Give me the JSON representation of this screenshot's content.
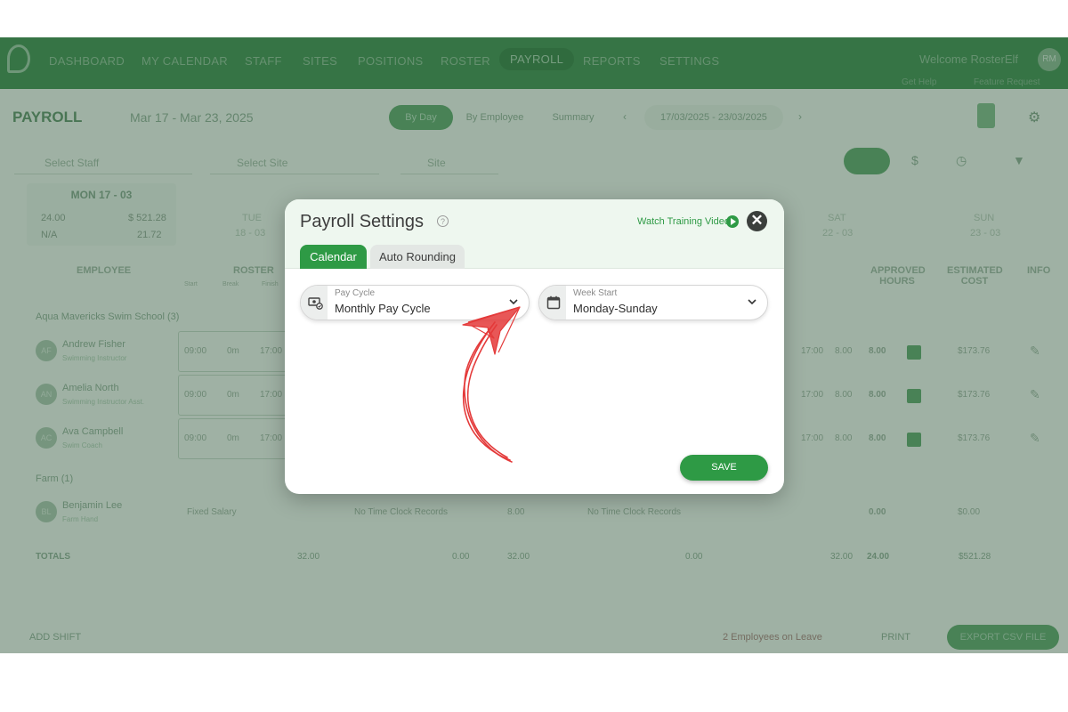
{
  "nav": {
    "items": [
      "DASHBOARD",
      "MY CALENDAR",
      "STAFF",
      "SITES",
      "POSITIONS",
      "ROSTER",
      "PAYROLL",
      "REPORTS",
      "SETTINGS"
    ],
    "active": "PAYROLL",
    "welcome": "Welcome RosterElf",
    "avatar": "RM",
    "get_help": "Get Help",
    "feature_request": "Feature Request"
  },
  "toolbar": {
    "title": "PAYROLL",
    "date_range": "Mar 17 - Mar 23, 2025",
    "seg_by_day": "By Day",
    "seg_by_employee": "By Employee",
    "seg_summary": "Summary",
    "range_value": "17/03/2025 - 23/03/2025"
  },
  "filters": {
    "staff": "Select Staff",
    "site": "Select Site",
    "group": "Site"
  },
  "day_card": {
    "title": "MON 17 - 03",
    "hours": "24.00",
    "cost": "$ 521.28",
    "pct": "N/A",
    "avg": "21.72"
  },
  "other_days": [
    {
      "label": "TUE",
      "date": "18 - 03"
    },
    {
      "label": "SAT",
      "date": "22 - 03"
    },
    {
      "label": "SUN",
      "date": "23 - 03"
    }
  ],
  "table": {
    "h_employee": "EMPLOYEE",
    "h_roster": "ROSTER",
    "h_approved": "APPROVED HOURS",
    "h_est_cost": "ESTIMATED COST",
    "h_info": "INFO",
    "sub_start": "Start",
    "sub_break": "Break",
    "sub_finish": "Finish",
    "group1": "Aqua Mavericks Swim School (3)",
    "group2": "Farm (1)",
    "rows": [
      {
        "initials": "AF",
        "name": "Andrew Fisher",
        "role": "Swimming Instructor",
        "start": "09:00",
        "brk": "0m",
        "finish": "17:00",
        "end": "17:00",
        "hrs": "8.00",
        "appr": "8.00",
        "cost": "$173.76"
      },
      {
        "initials": "AN",
        "name": "Amelia North",
        "role": "Swimming Instructor Asst.",
        "start": "09:00",
        "brk": "0m",
        "finish": "17:00",
        "end": "17:00",
        "hrs": "8.00",
        "appr": "8.00",
        "cost": "$173.76"
      },
      {
        "initials": "AC",
        "name": "Ava Campbell",
        "role": "Swim Coach",
        "start": "09:00",
        "brk": "0m",
        "finish": "17:00",
        "end": "17:00",
        "hrs": "8.00",
        "appr": "8.00",
        "cost": "$173.76"
      }
    ],
    "farm_row": {
      "initials": "BL",
      "name": "Benjamin Lee",
      "role": "Farm Hand",
      "rostered": "Fixed Salary",
      "clock": "No Time Clock Records",
      "hrs": "8.00",
      "clock2": "No Time Clock Records",
      "appr": "0.00",
      "cost": "$0.00"
    },
    "totals_label": "TOTALS",
    "totals": [
      "32.00",
      "0.00",
      "32.00",
      "0.00",
      "32.00",
      "24.00",
      "$521.28"
    ]
  },
  "footer": {
    "add_shift": "ADD SHIFT",
    "leave": "2 Employees on Leave",
    "print": "PRINT",
    "export": "EXPORT CSV FILE"
  },
  "modal": {
    "title": "Payroll Settings",
    "help": "?",
    "watch": "Watch Training Video",
    "close": "✕",
    "tab_calendar": "Calendar",
    "tab_auto": "Auto Rounding",
    "pay_cycle_label": "Pay Cycle",
    "pay_cycle_value": "Monthly Pay Cycle",
    "week_start_label": "Week Start",
    "week_start_value": "Monday-Sunday",
    "save": "SAVE"
  },
  "colors": {
    "brand_green": "#2e9a45",
    "annotation_red": "#e43a3a"
  }
}
